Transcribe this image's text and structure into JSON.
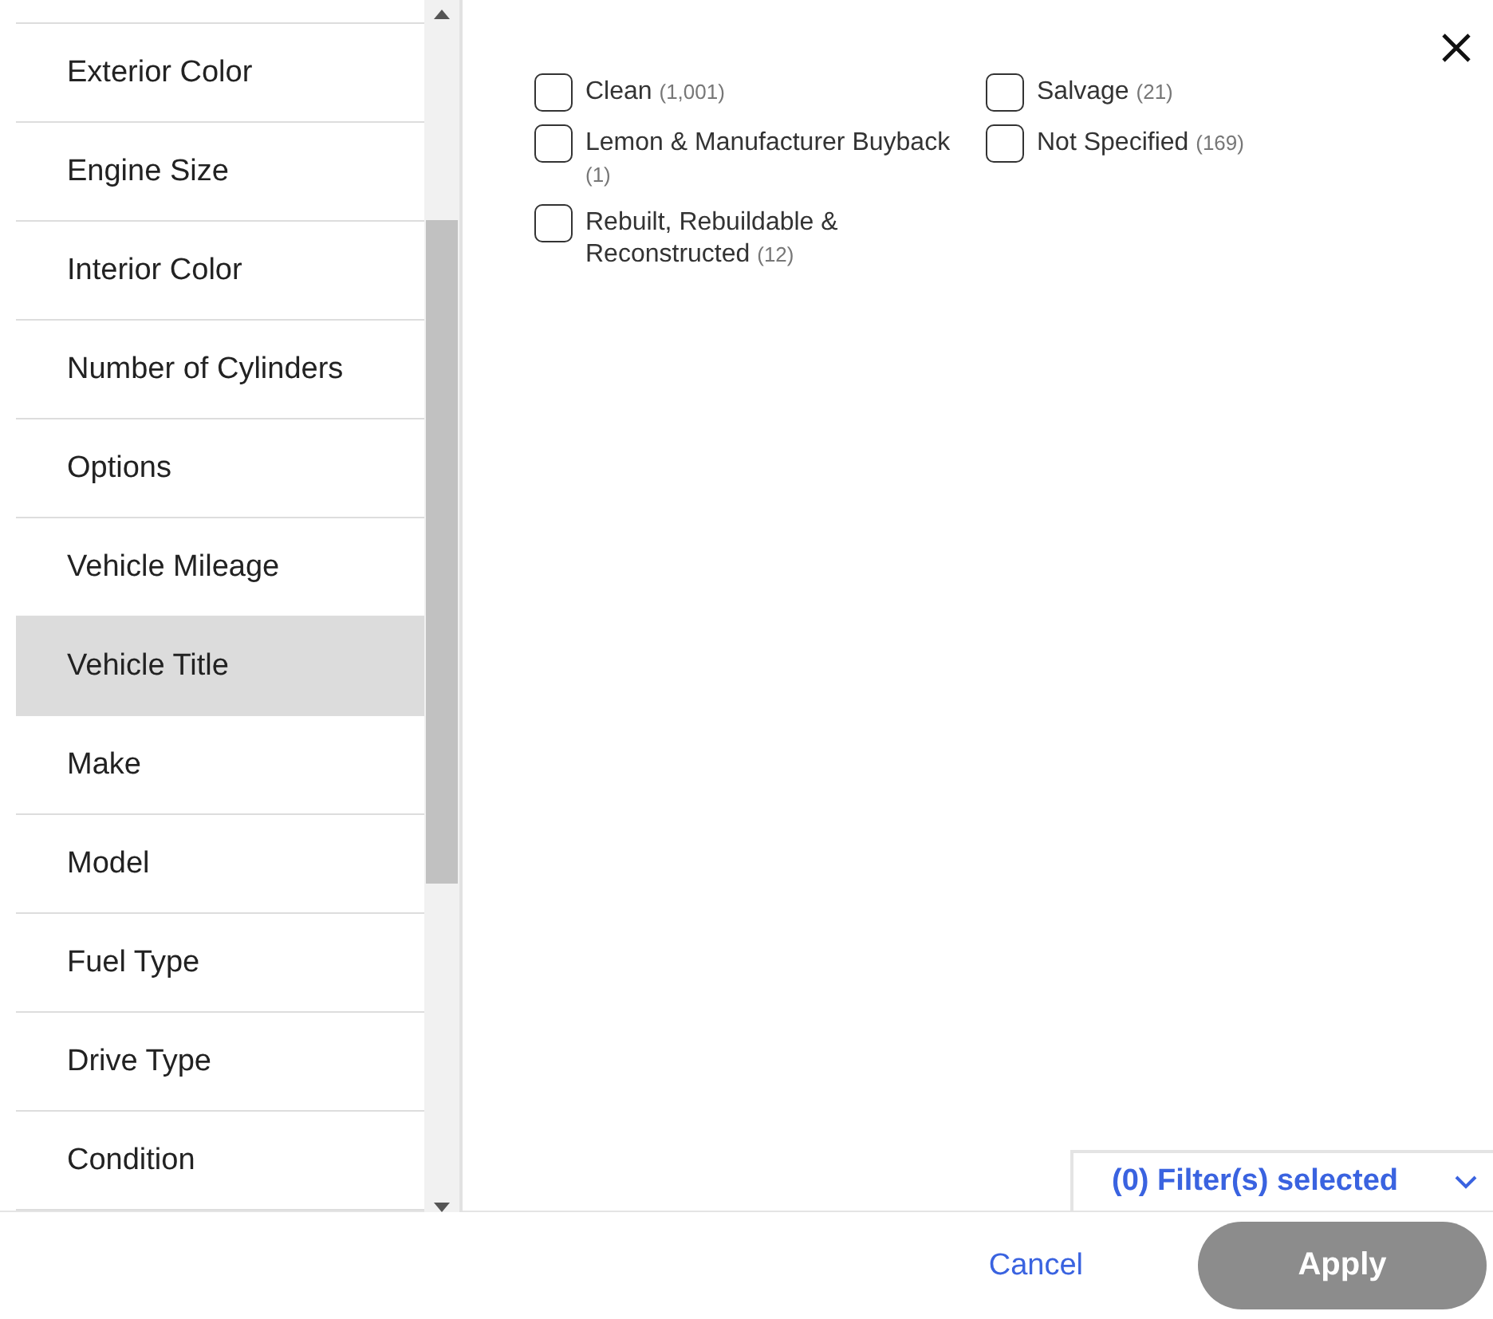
{
  "sidebar": {
    "items": [
      {
        "label": "Exterior Color",
        "selected": false
      },
      {
        "label": "Engine Size",
        "selected": false
      },
      {
        "label": "Interior Color",
        "selected": false
      },
      {
        "label": "Number of Cylinders",
        "selected": false
      },
      {
        "label": "Options",
        "selected": false
      },
      {
        "label": "Vehicle Mileage",
        "selected": false
      },
      {
        "label": "Vehicle Title",
        "selected": true
      },
      {
        "label": "Make",
        "selected": false
      },
      {
        "label": "Model",
        "selected": false
      },
      {
        "label": "Fuel Type",
        "selected": false
      },
      {
        "label": "Drive Type",
        "selected": false
      },
      {
        "label": "Condition",
        "selected": false
      }
    ]
  },
  "options": [
    {
      "label": "Clean",
      "count": "(1,001)",
      "checked": false
    },
    {
      "label": "Salvage",
      "count": "(21)",
      "checked": false
    },
    {
      "label": "Lemon & Manufacturer Buyback",
      "count": "(1)",
      "checked": false
    },
    {
      "label": "Not Specified",
      "count": "(169)",
      "checked": false
    },
    {
      "label": "Rebuilt, Rebuildable & Reconstructed",
      "count": "(12)",
      "checked": false
    }
  ],
  "filter_summary": "(0) Filter(s) selected",
  "footer": {
    "cancel": "Cancel",
    "apply": {
      "label": "Apply",
      "disabled": true
    }
  }
}
